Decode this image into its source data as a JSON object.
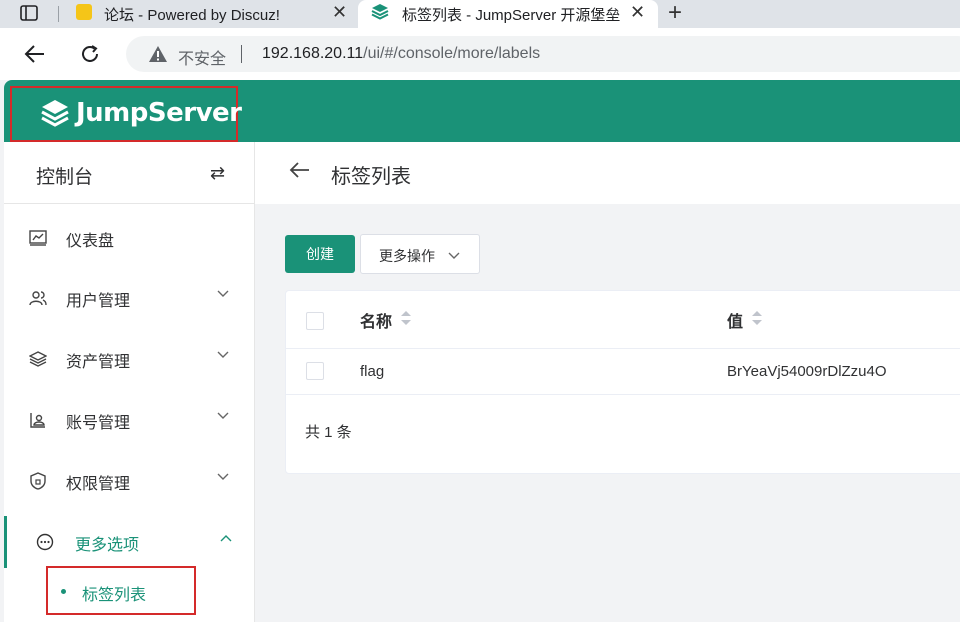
{
  "browser": {
    "tabs": [
      {
        "title": "论坛 - Powered by Discuz!",
        "active": false
      },
      {
        "title": "标签列表 - JumpServer 开源堡垒",
        "active": true
      }
    ],
    "address": {
      "security_label": "不安全",
      "host": "192.168.20.11",
      "path": "/ui/#/console/more/labels"
    }
  },
  "app": {
    "logo_text": "JumpServer",
    "brand_color": "#1a9278",
    "sidebar": {
      "title": "控制台",
      "switch_icon": "⇄",
      "items": [
        {
          "label": "仪表盘",
          "icon": "dashboard-icon"
        },
        {
          "label": "用户管理",
          "icon": "users-icon"
        },
        {
          "label": "资产管理",
          "icon": "layers-icon"
        },
        {
          "label": "账号管理",
          "icon": "account-icon"
        },
        {
          "label": "权限管理",
          "icon": "shield-icon"
        },
        {
          "label": "更多选项",
          "icon": "more-icon"
        }
      ],
      "submenu_label": "标签列表"
    },
    "page_title": "标签列表",
    "toolbar": {
      "create_label": "创建",
      "more_label": "更多操作"
    },
    "table": {
      "columns": [
        "名称",
        "值"
      ],
      "rows": [
        {
          "name": "flag",
          "value": "BrYeaVj54009rDlZzu4O"
        }
      ],
      "total_label": "共 1 条"
    }
  }
}
